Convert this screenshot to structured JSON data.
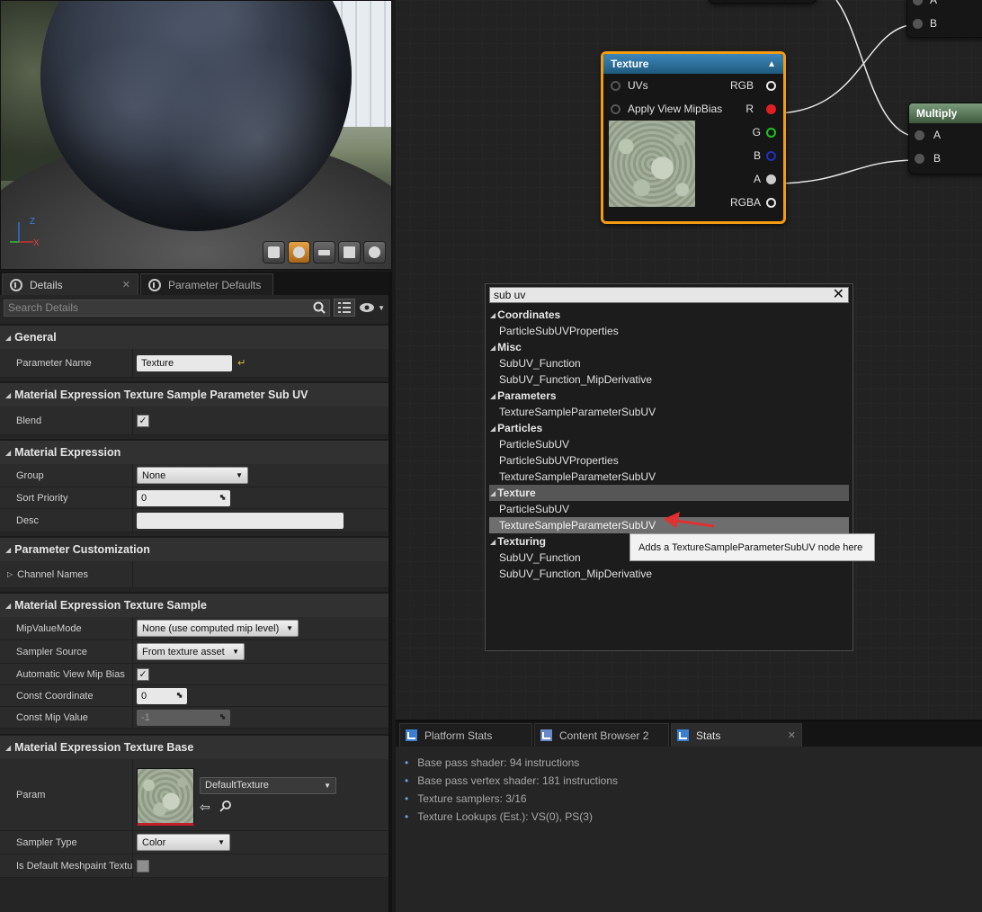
{
  "details_tabs": [
    {
      "label": "Details",
      "close": "✕"
    },
    {
      "label": "Parameter Defaults",
      "close": ""
    }
  ],
  "search": {
    "placeholder": "Search Details"
  },
  "sections": {
    "general": "General",
    "subuv": "Material Expression Texture Sample Parameter Sub UV",
    "expr": "Material Expression",
    "custom": "Parameter Customization",
    "sample": "Material Expression Texture Sample",
    "base": "Material Expression Texture Base"
  },
  "props": {
    "param_name_label": "Parameter Name",
    "param_name_value": "Texture",
    "blend_label": "Blend",
    "group_label": "Group",
    "group_value": "None",
    "sort_label": "Sort Priority",
    "sort_value": "0",
    "desc_label": "Desc",
    "channel_label": "Channel Names",
    "mip_mode_label": "MipValueMode",
    "mip_mode_value": "None (use computed mip level)",
    "sampler_source_label": "Sampler Source",
    "sampler_source_value": "From texture asset",
    "auto_mip_label": "Automatic View Mip Bias",
    "const_coord_label": "Const Coordinate",
    "const_coord_value": "0",
    "const_mip_label": "Const Mip Value",
    "const_mip_value": "-1",
    "param_label": "Param",
    "param_value": "DefaultTexture",
    "sampler_type_label": "Sampler Type",
    "sampler_type_value": "Color",
    "meshpaint_label": "Is Default Meshpaint Texture"
  },
  "axis": {
    "z": "Z",
    "x": "X"
  },
  "texture_node": {
    "title": "Texture",
    "inputs": [
      "UVs",
      "Apply View MipBias"
    ],
    "outputs": [
      "RGB",
      "R",
      "G",
      "B",
      "A",
      "RGBA"
    ]
  },
  "multiply_node": {
    "title": "Multiply",
    "inputs": [
      "A",
      "B"
    ]
  },
  "top_node": {
    "inputs": [
      "A",
      "B"
    ]
  },
  "context_menu": {
    "query": "sub uv",
    "groups": [
      {
        "name": "Coordinates",
        "items": [
          "ParticleSubUVProperties"
        ]
      },
      {
        "name": "Misc",
        "items": [
          "SubUV_Function",
          "SubUV_Function_MipDerivative"
        ]
      },
      {
        "name": "Parameters",
        "items": [
          "TextureSampleParameterSubUV"
        ]
      },
      {
        "name": "Particles",
        "items": [
          "ParticleSubUV",
          "ParticleSubUVProperties",
          "TextureSampleParameterSubUV"
        ]
      },
      {
        "name": "Texture",
        "items": [
          "ParticleSubUV",
          "TextureSampleParameterSubUV"
        ]
      },
      {
        "name": "Texturing",
        "items": [
          "SubUV_Function",
          "SubUV_Function_MipDerivative"
        ]
      }
    ],
    "tooltip": "Adds a TextureSampleParameterSubUV node here"
  },
  "bottom_tabs": [
    "Platform Stats",
    "Content Browser 2",
    "Stats"
  ],
  "stats": [
    "Base pass shader: 94 instructions",
    "Base pass vertex shader: 181 instructions",
    "Texture samplers: 3/16",
    "Texture Lookups (Est.): VS(0), PS(3)"
  ],
  "colors": {
    "selected_border": "#f39c12",
    "pin_r": "#e02020",
    "pin_g": "#20c020",
    "pin_b": "#2030c0",
    "texture_header": "#2a6f9a",
    "multiply_header": "#5a7a5a"
  }
}
